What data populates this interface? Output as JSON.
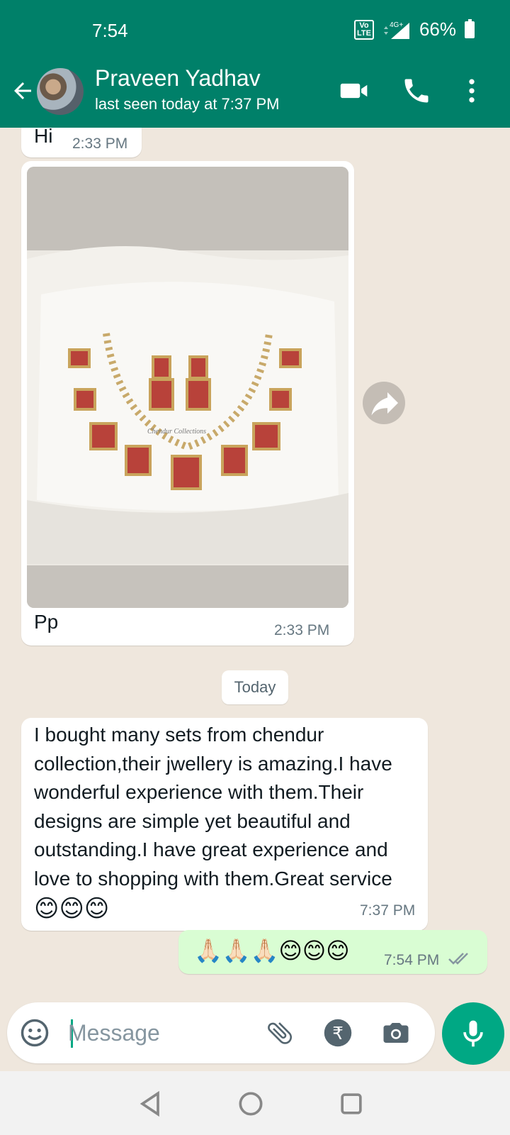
{
  "status_bar": {
    "time": "7:54",
    "network": "4G+",
    "volte": "Vo LTE",
    "battery": "66%"
  },
  "header": {
    "contact_name": "Praveen Yadhav",
    "contact_status": "last seen today at 7:37 PM"
  },
  "messages": {
    "hi": {
      "text": "Hi",
      "time": "2:33 PM"
    },
    "image": {
      "caption": "Pp",
      "time": "2:33 PM",
      "watermark": "Chendur Collections"
    },
    "date_divider": "Today",
    "review": {
      "lines": [
        "I bought many sets from chendur",
        "collection,their jwellery is amazing.I have",
        "wonderful experience with them.Their",
        "designs are simple yet beautiful and",
        "outstanding.I have great experience and",
        "love to shopping with them.Great service"
      ],
      "emojis": "😊😊😊",
      "time": "7:37 PM"
    },
    "reply": {
      "emojis": "🙏🏻🙏🏻🙏🏻😊😊😊",
      "time": "7:54 PM"
    }
  },
  "composer": {
    "placeholder": "Message"
  },
  "colors": {
    "header": "#008069",
    "accent": "#00a884",
    "outgoing": "#d9fdd3",
    "chat_bg": "#efe7dd"
  }
}
